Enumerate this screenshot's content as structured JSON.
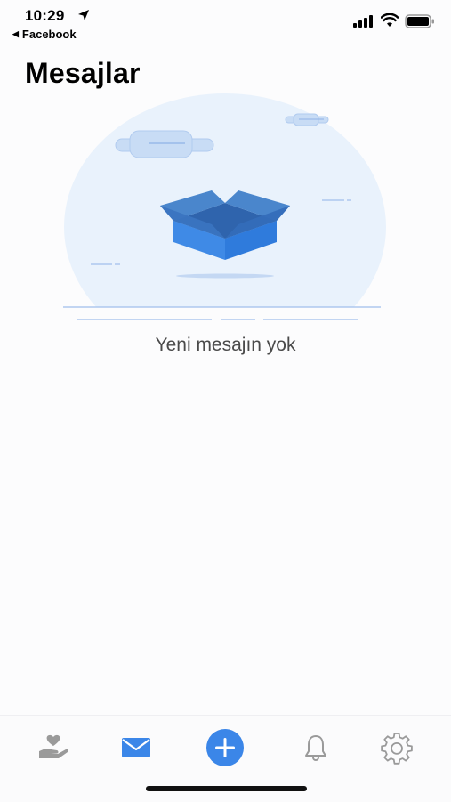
{
  "status_bar": {
    "time": "10:29",
    "back_app": "Facebook",
    "icons": [
      "location-arrow-icon",
      "signal-icon",
      "wifi-icon",
      "battery-icon"
    ]
  },
  "header": {
    "title": "Mesajlar"
  },
  "empty_state": {
    "illustration": "open-box-illustration",
    "message": "Yeni mesajın yok"
  },
  "tab_bar": {
    "items": [
      {
        "icon": "heart-hand-icon",
        "active": false
      },
      {
        "icon": "envelope-icon",
        "active": true
      },
      {
        "icon": "plus-circle-icon",
        "active": false
      },
      {
        "icon": "bell-icon",
        "active": false
      },
      {
        "icon": "gear-icon",
        "active": false
      }
    ]
  },
  "colors": {
    "accent": "#3b86e8",
    "illustration_bg": "#e9f2fc",
    "inactive_icon": "#9a9a9a"
  }
}
